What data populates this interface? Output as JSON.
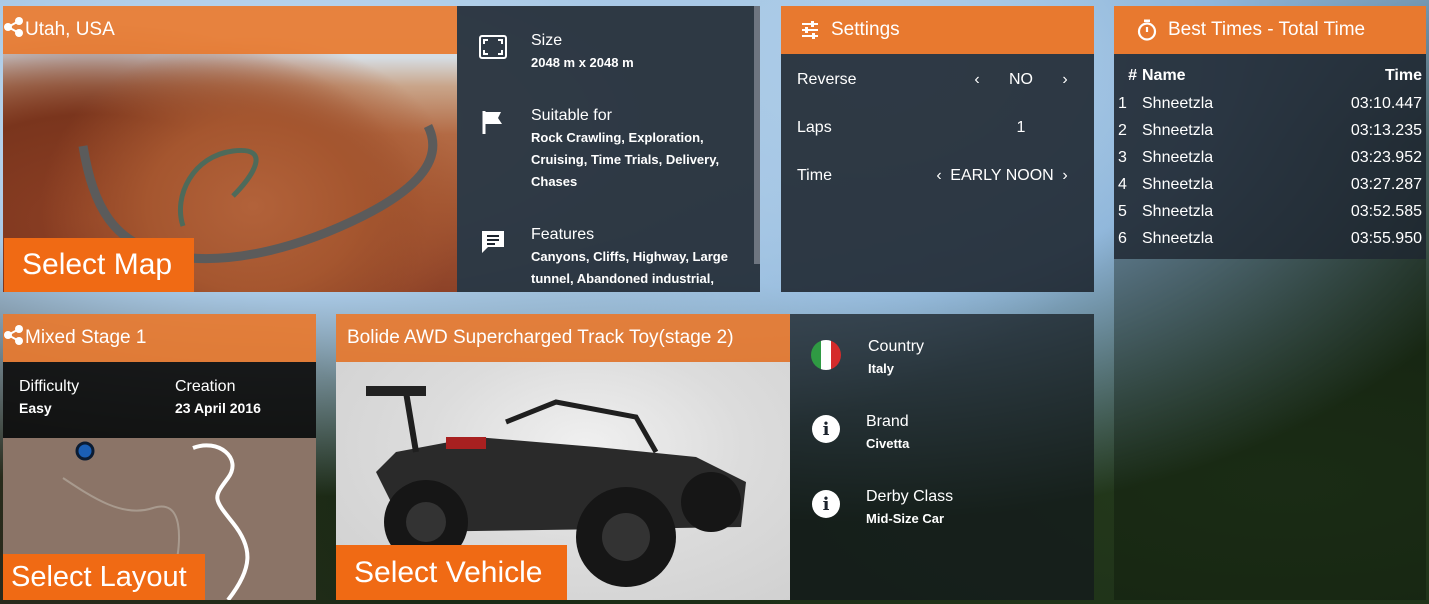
{
  "colors": {
    "accent": "#e8792f",
    "button": "#f06a14",
    "panel": "#1c242e"
  },
  "map_card": {
    "title": "Utah, USA",
    "icon": "map-share-icon",
    "select_label": "Select Map"
  },
  "map_info": {
    "rows": [
      {
        "icon": "size-frame-icon",
        "label": "Size",
        "value": "2048 m x 2048 m"
      },
      {
        "icon": "flag-icon",
        "label": "Suitable for",
        "value": "Rock Crawling, Exploration, Cruising, Time Trials, Delivery, Chases"
      },
      {
        "icon": "comment-icon",
        "label": "Features",
        "value": "Canyons, Cliffs, Highway, Large tunnel, Abandoned industrial,"
      }
    ]
  },
  "settings": {
    "title": "Settings",
    "icon": "sliders-icon",
    "reverse": {
      "label": "Reverse",
      "value": "NO"
    },
    "laps": {
      "label": "Laps",
      "value": "1"
    },
    "time": {
      "label": "Time",
      "value": "EARLY NOON"
    }
  },
  "best_times": {
    "title": "Best Times - Total Time",
    "icon": "stopwatch-icon",
    "headers": {
      "rank": "#",
      "name": "Name",
      "time": "Time"
    },
    "rows": [
      {
        "rank": "1",
        "name": "Shneetzla",
        "time": "03:10.447"
      },
      {
        "rank": "2",
        "name": "Shneetzla",
        "time": "03:13.235"
      },
      {
        "rank": "3",
        "name": "Shneetzla",
        "time": "03:23.952"
      },
      {
        "rank": "4",
        "name": "Shneetzla",
        "time": "03:27.287"
      },
      {
        "rank": "5",
        "name": "Shneetzla",
        "time": "03:52.585"
      },
      {
        "rank": "6",
        "name": "Shneetzla",
        "time": "03:55.950"
      }
    ]
  },
  "layout_card": {
    "title": "Mixed Stage 1",
    "icon": "map-share-icon",
    "difficulty_label": "Difficulty",
    "difficulty_value": "Easy",
    "creation_label": "Creation",
    "creation_value": "23 April 2016",
    "select_label": "Select Layout"
  },
  "vehicle_card": {
    "title": "Bolide AWD Supercharged Track Toy(stage 2)",
    "select_label": "Select Vehicle"
  },
  "vehicle_info": {
    "country": {
      "icon": "italy-flag-icon",
      "label": "Country",
      "value": "Italy"
    },
    "brand": {
      "icon": "info-icon",
      "label": "Brand",
      "value": "Civetta"
    },
    "derby": {
      "icon": "info-icon",
      "label": "Derby Class",
      "value": "Mid-Size Car"
    }
  }
}
